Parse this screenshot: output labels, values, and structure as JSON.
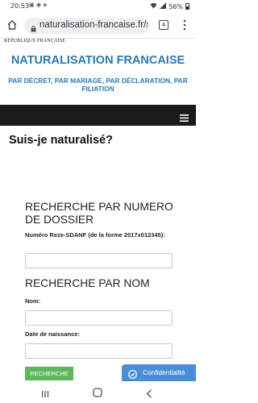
{
  "status_bar": {
    "time": "20:53",
    "battery": "56%"
  },
  "browser": {
    "url": "naturalisation-francaise.fr/s",
    "tab_count": "4"
  },
  "site": {
    "republique": "RÉPUBLIQUE FRANÇAISE",
    "title": "NATURALISATION FRANCAISE",
    "subtitle": "PAR DÉCRET, PAR MARIAGE, PAR DÉCLARATION, PAR FILIATION"
  },
  "page": {
    "title": "Suis-je naturalisé?",
    "section_dossier": "RECHERCHE PAR NUMERO DE DOSSIER",
    "label_dossier": "Numéro Reze-SDANF (de la forme 2017x012345):",
    "section_nom": "RECHERCHE PAR NOM",
    "label_nom": "Nom:",
    "label_date": "Date de naissance:",
    "search_button": "RECHERCHE",
    "confidentialite": "Confidentialité"
  },
  "colors": {
    "title_blue": "#2a7ab0",
    "nav_dark": "#1b1b1b",
    "button_green": "#5cb85c",
    "privacy_blue": "#4a8fd6"
  }
}
